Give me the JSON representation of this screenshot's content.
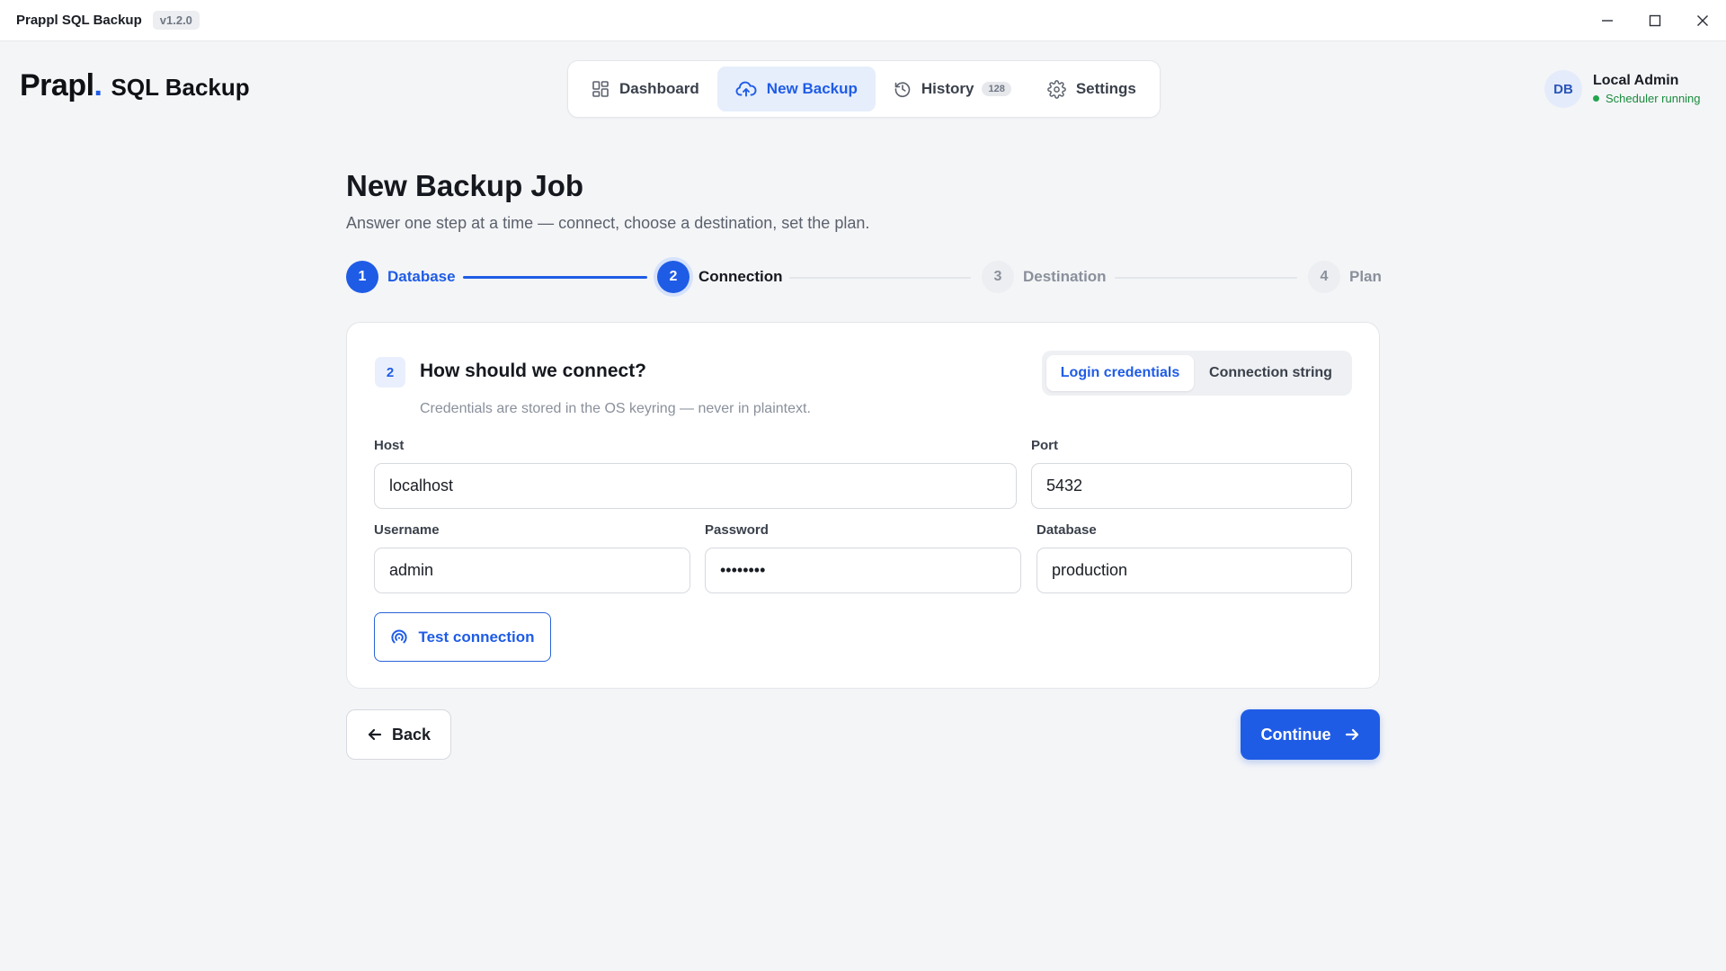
{
  "window": {
    "title": "Prappl SQL Backup",
    "version": "v1.2.0"
  },
  "brand": {
    "mark": "Prapl",
    "dot": ".",
    "product": "SQL Backup"
  },
  "nav": {
    "items": [
      {
        "label": "Dashboard",
        "icon": "dashboard-grid-icon",
        "active": false
      },
      {
        "label": "New Backup",
        "icon": "cloud-upload-icon",
        "active": true
      },
      {
        "label": "History",
        "icon": "history-clock-icon",
        "active": false,
        "badge": "128"
      },
      {
        "label": "Settings",
        "icon": "gear-icon",
        "active": false
      }
    ]
  },
  "user": {
    "initials": "DB",
    "name": "Local Admin",
    "status": "Scheduler running"
  },
  "page": {
    "title": "New Backup Job",
    "subtitle": "Answer one step at a time — connect, choose a destination, set the plan."
  },
  "steps": [
    {
      "number": "1",
      "label": "Database",
      "state": "done"
    },
    {
      "number": "2",
      "label": "Connection",
      "state": "current"
    },
    {
      "number": "3",
      "label": "Destination",
      "state": "todo"
    },
    {
      "number": "4",
      "label": "Plan",
      "state": "todo"
    }
  ],
  "card": {
    "step_number": "2",
    "title": "How should we connect?",
    "help": "Credentials are stored in the OS keyring — never in plaintext.",
    "modes": {
      "selected": "Login credentials",
      "other": "Connection string"
    },
    "fields": {
      "host": {
        "label": "Host",
        "value": "localhost"
      },
      "port": {
        "label": "Port",
        "value": "5432"
      },
      "username": {
        "label": "Username",
        "value": "admin"
      },
      "password": {
        "label": "Password",
        "value": "••••••••"
      },
      "database": {
        "label": "Database",
        "value": "production"
      }
    },
    "test_button": "Test connection"
  },
  "actions": {
    "back": "Back",
    "continue": "Continue"
  },
  "colors": {
    "accent": "#1f5ce6",
    "status_ok": "#22a54d",
    "background": "#f4f5f7"
  }
}
